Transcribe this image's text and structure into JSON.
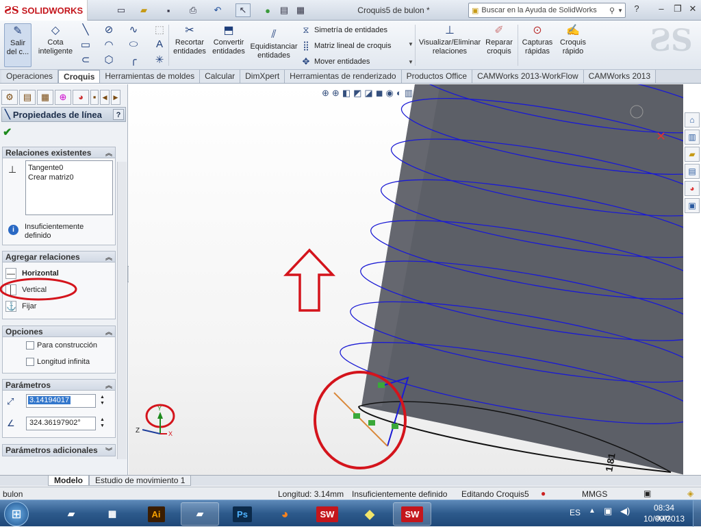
{
  "app": {
    "brand": "SOLIDWORKS",
    "document_title": "Croquis5 de bulon *",
    "help_search_placeholder": "Buscar en la Ayuda de SolidWorks"
  },
  "ribbon": {
    "exit_sketch": "Salir del c...",
    "smart_dimension": "Cota inteligente",
    "trim": "Recortar entidades",
    "convert": "Convertir entidades",
    "offset": "Equidistanciar entidades",
    "mirror": "Simetría de entidades",
    "linear_pattern": "Matriz lineal de croquis",
    "move": "Mover entidades",
    "display_relations": "Visualizar/Eliminar relaciones",
    "repair": "Reparar croquis",
    "quick_snaps": "Capturas rápidas",
    "rapid_sketch": "Croquis rápido"
  },
  "tabs": [
    {
      "label": "Operaciones",
      "active": false
    },
    {
      "label": "Croquis",
      "active": true
    },
    {
      "label": "Herramientas de moldes",
      "active": false
    },
    {
      "label": "Calcular",
      "active": false
    },
    {
      "label": "DimXpert",
      "active": false
    },
    {
      "label": "Herramientas de renderizado",
      "active": false
    },
    {
      "label": "Productos Office",
      "active": false
    },
    {
      "label": "CAMWorks 2013-WorkFlow",
      "active": false
    },
    {
      "label": "CAMWorks 2013",
      "active": false
    }
  ],
  "property_manager": {
    "title": "Propiedades de línea",
    "help": "?",
    "existing_relations": {
      "header": "Relaciones existentes",
      "items": [
        "Tangente0",
        "Crear matriz0"
      ],
      "status": "Insuficientemente definido"
    },
    "add_relations": {
      "header": "Agregar relaciones",
      "items": [
        "Horizontal",
        "Vertical",
        "Fijar"
      ]
    },
    "options": {
      "header": "Opciones",
      "for_construction": "Para construcción",
      "infinite_length": "Longitud infinita"
    },
    "parameters": {
      "header": "Parámetros",
      "length": "3.14194017",
      "angle": "324.36197902°"
    },
    "additional": {
      "header": "Parámetros adicionales"
    }
  },
  "viewport": {
    "dimension_label": "1.81",
    "axis_x": "X",
    "axis_y": "Y",
    "axis_z": "Z"
  },
  "bottom_tabs": [
    "Modelo",
    "Estudio de movimiento 1"
  ],
  "status": {
    "part": "bulon",
    "length": "Longitud: 3.14mm",
    "definition": "Insuficientemente definido",
    "editing": "Editando Croquis5",
    "units": "MMGS"
  },
  "taskbar": {
    "language": "ES",
    "time": "08:34 a.m.",
    "date": "10/09/2013",
    "apps": [
      "Ai",
      "Ps",
      "SW",
      "SW"
    ]
  },
  "colors": {
    "annotation_red": "#d4141c",
    "sketch_blue": "#1a1ad4",
    "cylinder": "#5b5e66",
    "selected_line": "#d9883a"
  }
}
